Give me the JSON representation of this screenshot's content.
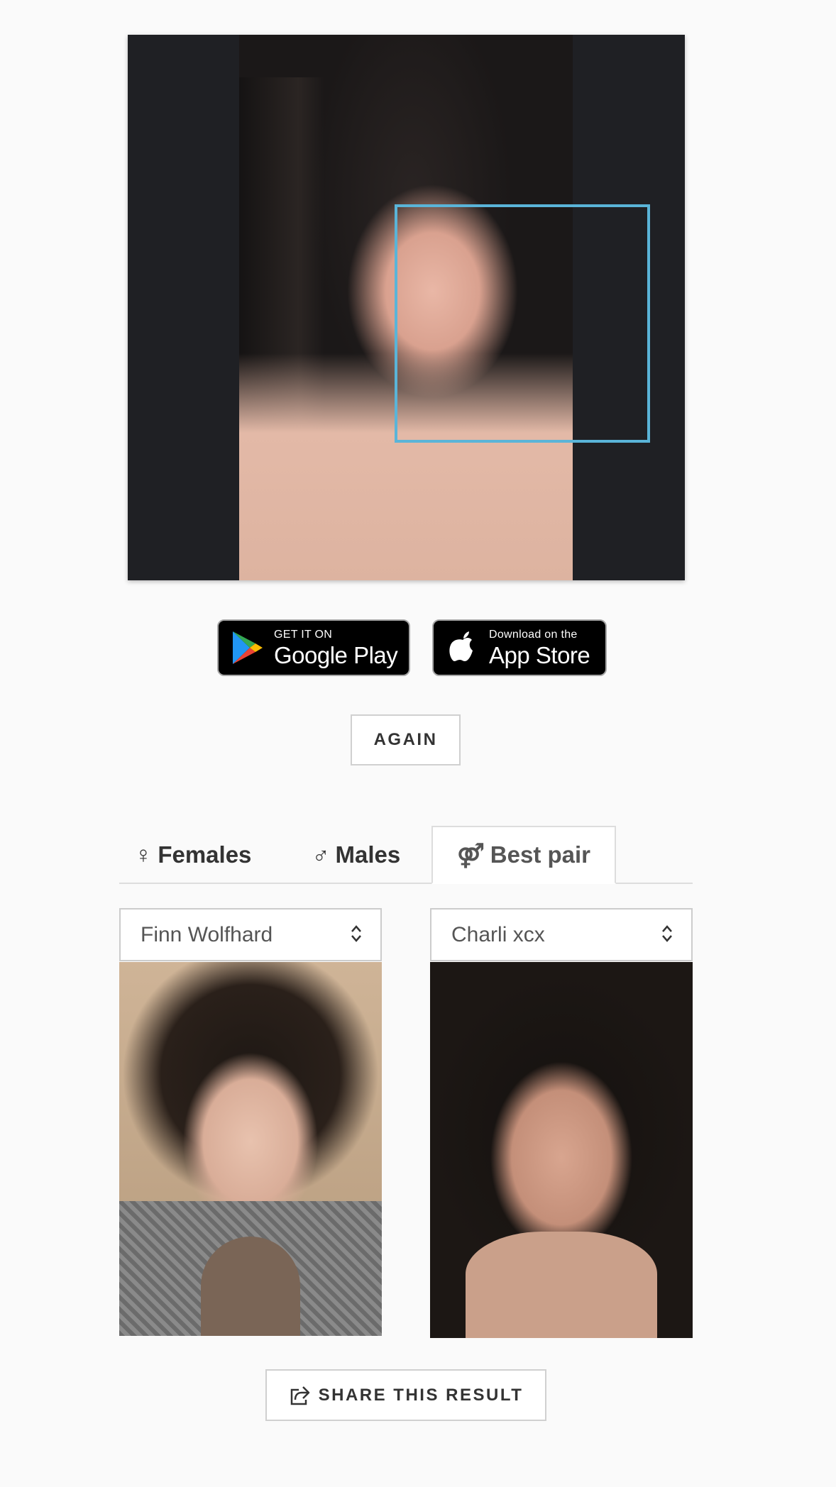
{
  "photo": {
    "face_box_color": "#5ab4d8"
  },
  "stores": {
    "google": {
      "small": "GET IT ON",
      "big": "Google Play",
      "icon": "google-play-icon"
    },
    "apple": {
      "small": "Download on the",
      "big": "App Store",
      "icon": "apple-icon"
    }
  },
  "again_label": "AGAIN",
  "tabs": [
    {
      "symbol": "♀",
      "label": "Females",
      "active": false
    },
    {
      "symbol": "♂",
      "label": "Males",
      "active": false
    },
    {
      "symbol": "⚤",
      "label": "Best pair",
      "active": true
    }
  ],
  "pair": {
    "left": {
      "name": "Finn Wolfhard"
    },
    "right": {
      "name": "Charli xcx"
    }
  },
  "share_label": "SHARE THIS RESULT"
}
